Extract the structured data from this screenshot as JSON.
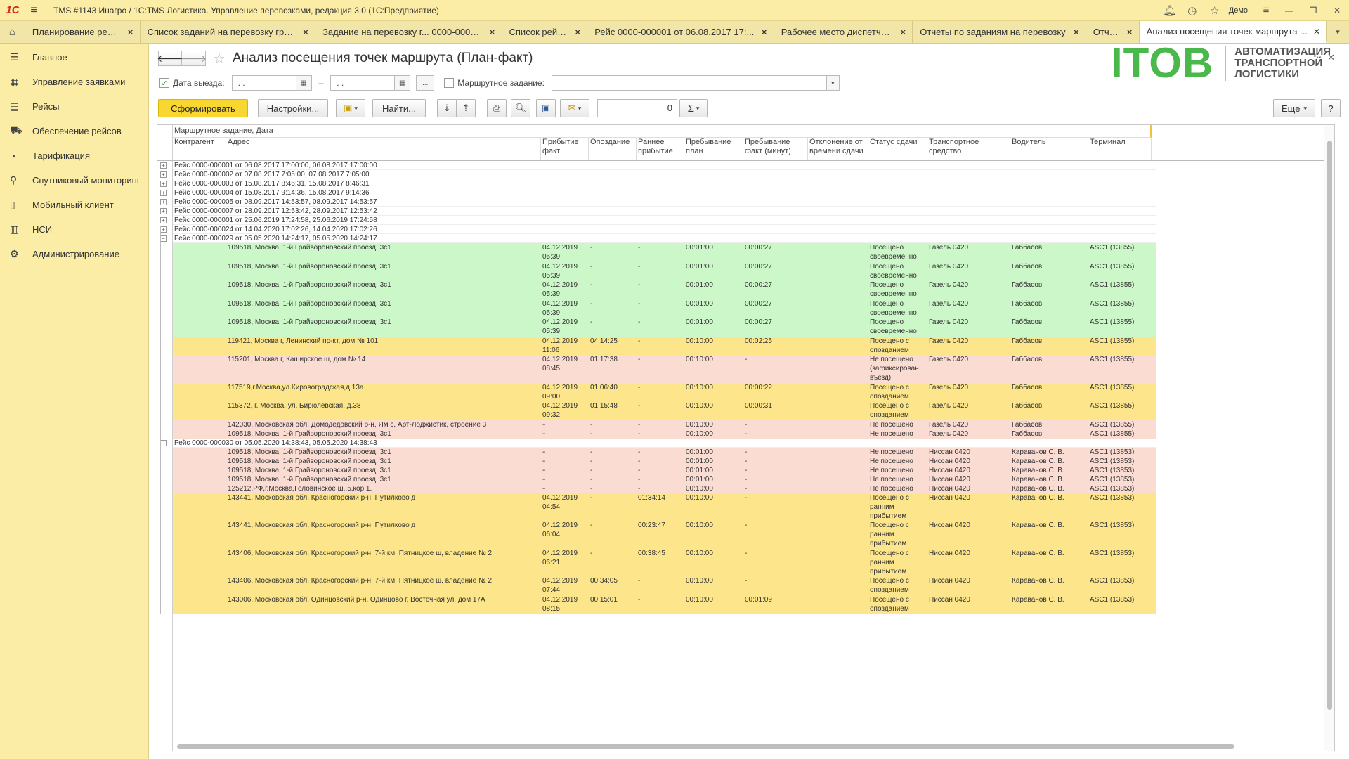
{
  "window": {
    "logo": "1С",
    "title": "TMS #1143 Инагро / 1С:TMS Логистика. Управление перевозками, редакция 3.0  (1С:Предприятие)",
    "user": "Демо"
  },
  "tabs": [
    {
      "label": "Планирование рейсов",
      "w": 164
    },
    {
      "label": "Список заданий на перевозку груза",
      "w": 250
    },
    {
      "label": "Задание на перевозку г... 0000-000010",
      "w": 266
    },
    {
      "label": "Список рейсов",
      "w": 122
    },
    {
      "label": "Рейс 0000-000001 от 06.08.2017 17:...",
      "w": 266
    },
    {
      "label": "Рабочее место диспетчера",
      "w": 198
    },
    {
      "label": "Отчеты по заданиям на перевозку",
      "w": 247
    },
    {
      "label": "Отчеты",
      "w": 76
    },
    {
      "label": "Анализ посещения точек маршрута ...",
      "w": 267,
      "active": true
    }
  ],
  "nav": [
    {
      "icon": "☰",
      "label": "Главное",
      "name": "nav-main"
    },
    {
      "icon": "▦",
      "label": "Управление заявками",
      "name": "nav-orders"
    },
    {
      "icon": "▤",
      "label": "Рейсы",
      "name": "nav-trips"
    },
    {
      "icon": "⛟",
      "label": "Обеспечение рейсов",
      "name": "nav-trip-supply"
    },
    {
      "icon": "◔",
      "label": "Тарификация",
      "name": "nav-tariffs"
    },
    {
      "icon": "⚲",
      "label": "Спутниковый мониторинг",
      "name": "nav-satellite"
    },
    {
      "icon": "▯",
      "label": "Мобильный клиент",
      "name": "nav-mobile"
    },
    {
      "icon": "▥",
      "label": "НСИ",
      "name": "nav-nsi"
    },
    {
      "icon": "⚙",
      "label": "Администрирование",
      "name": "nav-admin"
    }
  ],
  "page": {
    "title": "Анализ посещения точек маршрута (План-факт)"
  },
  "brand": {
    "big": "ITOB",
    "line1": "АВТОМАТИЗАЦИЯ",
    "line2": "ТРАНСПОРТНОЙ",
    "line3": "ЛОГИСТИКИ"
  },
  "filters": {
    "date_label": "Дата выезда:",
    "date_from": ".  .",
    "date_to": ".  .",
    "dash": "–",
    "more": "...",
    "route_label": "Маршрутное задание:",
    "date_checked": "✓"
  },
  "toolbar": {
    "generate": "Сформировать",
    "settings": "Настройки...",
    "find": "Найти...",
    "count": "0",
    "more": "Еще",
    "help": "?"
  },
  "report": {
    "group_header": "Маршрутное задание, Дата",
    "columns": [
      "Контрагент",
      "Адрес",
      "Прибытие\nфакт",
      "Опоздание",
      "Раннее\nприбытие",
      "Пребывание\nплан",
      "Пребывание\nфакт (минут)",
      "Отклонение от\nвремени сдачи",
      "Статус сдачи",
      "Транспортное\nсредство",
      "Водитель",
      "Терминал"
    ],
    "collapsed": [
      "Рейс 0000-000001 от 06.08.2017 17:00:00, 06.08.2017 17:00:00",
      "Рейс 0000-000002 от 07.08.2017 7:05:00, 07.08.2017 7:05:00",
      "Рейс 0000-000003 от 15.08.2017 8:46:31, 15.08.2017 8:46:31",
      "Рейс 0000-000004 от 15.08.2017 9:14:36, 15.08.2017 9:14:36",
      "Рейс 0000-000005 от 08.09.2017 14:53:57, 08.09.2017 14:53:57",
      "Рейс 0000-000007 от 28.09.2017 12:53:42, 28.09.2017 12:53:42",
      "Рейс 0000-000001 от 25.06.2019 17:24:58, 25.06.2019 17:24:58",
      "Рейс 0000-000024 от 14.04.2020 17:02:26, 14.04.2020 17:02:26"
    ],
    "groups": [
      {
        "label": "Рейс 0000-000029 от 05.05.2020 14:24:17, 05.05.2020 14:24:17",
        "rows": [
          {
            "s": "g",
            "addr": "109518, Москва, 1-й Грайвороновский проезд, 3с1",
            "arr": "04.12.2019\n05:39",
            "late": "-",
            "early": "-",
            "plan": "00:01:00",
            "fact": "00:00:27",
            "dev": "",
            "status": "Посещено\nсвоевременно",
            "veh": "Газель 0420",
            "drv": "Габбасов",
            "term": "ASC1 (13855)"
          },
          {
            "s": "g",
            "addr": "109518, Москва, 1-й Грайвороновский проезд, 3с1",
            "arr": "04.12.2019\n05:39",
            "late": "-",
            "early": "-",
            "plan": "00:01:00",
            "fact": "00:00:27",
            "dev": "",
            "status": "Посещено\nсвоевременно",
            "veh": "Газель 0420",
            "drv": "Габбасов",
            "term": "ASC1 (13855)"
          },
          {
            "s": "g",
            "addr": "109518, Москва, 1-й Грайвороновский проезд, 3с1",
            "arr": "04.12.2019\n05:39",
            "late": "-",
            "early": "-",
            "plan": "00:01:00",
            "fact": "00:00:27",
            "dev": "",
            "status": "Посещено\nсвоевременно",
            "veh": "Газель 0420",
            "drv": "Габбасов",
            "term": "ASC1 (13855)"
          },
          {
            "s": "g",
            "addr": "109518, Москва, 1-й Грайвороновский проезд, 3с1",
            "arr": "04.12.2019\n05:39",
            "late": "-",
            "early": "-",
            "plan": "00:01:00",
            "fact": "00:00:27",
            "dev": "",
            "status": "Посещено\nсвоевременно",
            "veh": "Газель 0420",
            "drv": "Габбасов",
            "term": "ASC1 (13855)"
          },
          {
            "s": "g",
            "addr": "109518, Москва, 1-й Грайвороновский проезд, 3с1",
            "arr": "04.12.2019\n05:39",
            "late": "-",
            "early": "-",
            "plan": "00:01:00",
            "fact": "00:00:27",
            "dev": "",
            "status": "Посещено\nсвоевременно",
            "veh": "Газель 0420",
            "drv": "Габбасов",
            "term": "ASC1 (13855)"
          },
          {
            "s": "y",
            "addr": "119421, Москва г, Ленинский пр-кт, дом № 101",
            "arr": "04.12.2019\n11:06",
            "late": "04:14:25",
            "early": "-",
            "plan": "00:10:00",
            "fact": "00:02:25",
            "dev": "",
            "status": "Посещено с\nопозданием",
            "veh": "Газель 0420",
            "drv": "Габбасов",
            "term": "ASC1 (13855)"
          },
          {
            "s": "r",
            "addr": "115201, Москва г, Каширское ш, дом № 14",
            "arr": "04.12.2019\n08:45",
            "late": "01:17:38",
            "early": "-",
            "plan": "00:10:00",
            "fact": "-",
            "dev": "",
            "status": "Не посещено\n(зафиксирован\nвъезд)",
            "veh": "Газель 0420",
            "drv": "Габбасов",
            "term": "ASC1 (13855)"
          },
          {
            "s": "y",
            "addr": "117519,г.Москва,ул.Кировоградская,д.13а.",
            "arr": "04.12.2019\n09:00",
            "late": "01:06:40",
            "early": "-",
            "plan": "00:10:00",
            "fact": "00:00:22",
            "dev": "",
            "status": "Посещено с\nопозданием",
            "veh": "Газель 0420",
            "drv": "Габбасов",
            "term": "ASC1 (13855)"
          },
          {
            "s": "y",
            "addr": "115372, г. Москва, ул. Бирюлевская, д.38",
            "arr": "04.12.2019\n09:32",
            "late": "01:15:48",
            "early": "-",
            "plan": "00:10:00",
            "fact": "00:00:31",
            "dev": "",
            "status": "Посещено с\nопозданием",
            "veh": "Газель 0420",
            "drv": "Габбасов",
            "term": "ASC1 (13855)"
          },
          {
            "s": "r",
            "addr": "142030, Московская обл, Домодедовский р-н, Ям с, Арт-Лоджистик, строение 3",
            "arr": "-",
            "late": "-",
            "early": "-",
            "plan": "00:10:00",
            "fact": "-",
            "dev": "",
            "status": "Не посещено",
            "veh": "Газель 0420",
            "drv": "Габбасов",
            "term": "ASC1 (13855)"
          },
          {
            "s": "r",
            "addr": "109518, Москва, 1-й Грайвороновский проезд, 3с1",
            "arr": "-",
            "late": "-",
            "early": "-",
            "plan": "00:10:00",
            "fact": "-",
            "dev": "",
            "status": "Не посещено",
            "veh": "Газель 0420",
            "drv": "Габбасов",
            "term": "ASC1 (13855)"
          }
        ]
      },
      {
        "label": "Рейс 0000-000030 от 05.05.2020 14:38:43, 05.05.2020 14:38:43",
        "rows": [
          {
            "s": "r",
            "addr": "109518, Москва, 1-й Грайвороновский проезд, 3с1",
            "arr": "-",
            "late": "-",
            "early": "-",
            "plan": "00:01:00",
            "fact": "-",
            "dev": "",
            "status": "Не посещено",
            "veh": "Ниссан 0420",
            "drv": "Караванов С. В.",
            "term": "ASC1 (13853)"
          },
          {
            "s": "r",
            "addr": "109518, Москва, 1-й Грайвороновский проезд, 3с1",
            "arr": "-",
            "late": "-",
            "early": "-",
            "plan": "00:01:00",
            "fact": "-",
            "dev": "",
            "status": "Не посещено",
            "veh": "Ниссан 0420",
            "drv": "Караванов С. В.",
            "term": "ASC1 (13853)"
          },
          {
            "s": "r",
            "addr": "109518, Москва, 1-й Грайвороновский проезд, 3с1",
            "arr": "-",
            "late": "-",
            "early": "-",
            "plan": "00:01:00",
            "fact": "-",
            "dev": "",
            "status": "Не посещено",
            "veh": "Ниссан 0420",
            "drv": "Караванов С. В.",
            "term": "ASC1 (13853)"
          },
          {
            "s": "r",
            "addr": "109518, Москва, 1-й Грайвороновский проезд, 3с1",
            "arr": "-",
            "late": "-",
            "early": "-",
            "plan": "00:01:00",
            "fact": "-",
            "dev": "",
            "status": "Не посещено",
            "veh": "Ниссан 0420",
            "drv": "Караванов С. В.",
            "term": "ASC1 (13853)"
          },
          {
            "s": "r",
            "addr": "125212,РФ,г.Москва,Головинское ш.,5,кор.1.",
            "arr": "-",
            "late": "-",
            "early": "-",
            "plan": "00:10:00",
            "fact": "-",
            "dev": "",
            "status": "Не посещено",
            "veh": "Ниссан 0420",
            "drv": "Караванов С. В.",
            "term": "ASC1 (13853)"
          },
          {
            "s": "y",
            "addr": "143441, Московская обл, Красногорский р-н, Путилково д",
            "arr": "04.12.2019\n04:54",
            "late": "-",
            "early": "01:34:14",
            "plan": "00:10:00",
            "fact": "-",
            "dev": "",
            "status": "Посещено с\nранним\nприбытием",
            "veh": "Ниссан 0420",
            "drv": "Караванов С. В.",
            "term": "ASC1 (13853)"
          },
          {
            "s": "y",
            "addr": "143441, Московская обл, Красногорский р-н, Путилково д",
            "arr": "04.12.2019\n06:04",
            "late": "-",
            "early": "00:23:47",
            "plan": "00:10:00",
            "fact": "-",
            "dev": "",
            "status": "Посещено с\nранним\nприбытием",
            "veh": "Ниссан 0420",
            "drv": "Караванов С. В.",
            "term": "ASC1 (13853)"
          },
          {
            "s": "y",
            "addr": "143406, Московская обл, Красногорский р-н, 7-й км, Пятницкое ш, владение № 2",
            "arr": "04.12.2019\n06:21",
            "late": "-",
            "early": "00:38:45",
            "plan": "00:10:00",
            "fact": "-",
            "dev": "",
            "status": "Посещено с\nранним\nприбытием",
            "veh": "Ниссан 0420",
            "drv": "Караванов С. В.",
            "term": "ASC1 (13853)"
          },
          {
            "s": "y",
            "addr": "143406, Московская обл, Красногорский р-н, 7-й км, Пятницкое ш, владение № 2",
            "arr": "04.12.2019\n07:44",
            "late": "00:34:05",
            "early": "-",
            "plan": "00:10:00",
            "fact": "-",
            "dev": "",
            "status": "Посещено с\nопозданием",
            "veh": "Ниссан 0420",
            "drv": "Караванов С. В.",
            "term": "ASC1 (13853)"
          },
          {
            "s": "y",
            "addr": "143006, Московская обл, Одинцовский р-н, Одинцово г, Восточная ул, дом 17А",
            "arr": "04.12.2019\n08:15",
            "late": "00:15:01",
            "early": "-",
            "plan": "00:10:00",
            "fact": "00:01:09",
            "dev": "",
            "status": "Посещено с\nопозданием",
            "veh": "Ниссан 0420",
            "drv": "Караванов С. В.",
            "term": "ASC1 (13853)"
          }
        ]
      }
    ]
  },
  "colors": {
    "g": "#ccf7c8",
    "y": "#fce58a",
    "r": "#fadcd3",
    "accent": "#f9d731",
    "panel": "#fbeca6"
  }
}
